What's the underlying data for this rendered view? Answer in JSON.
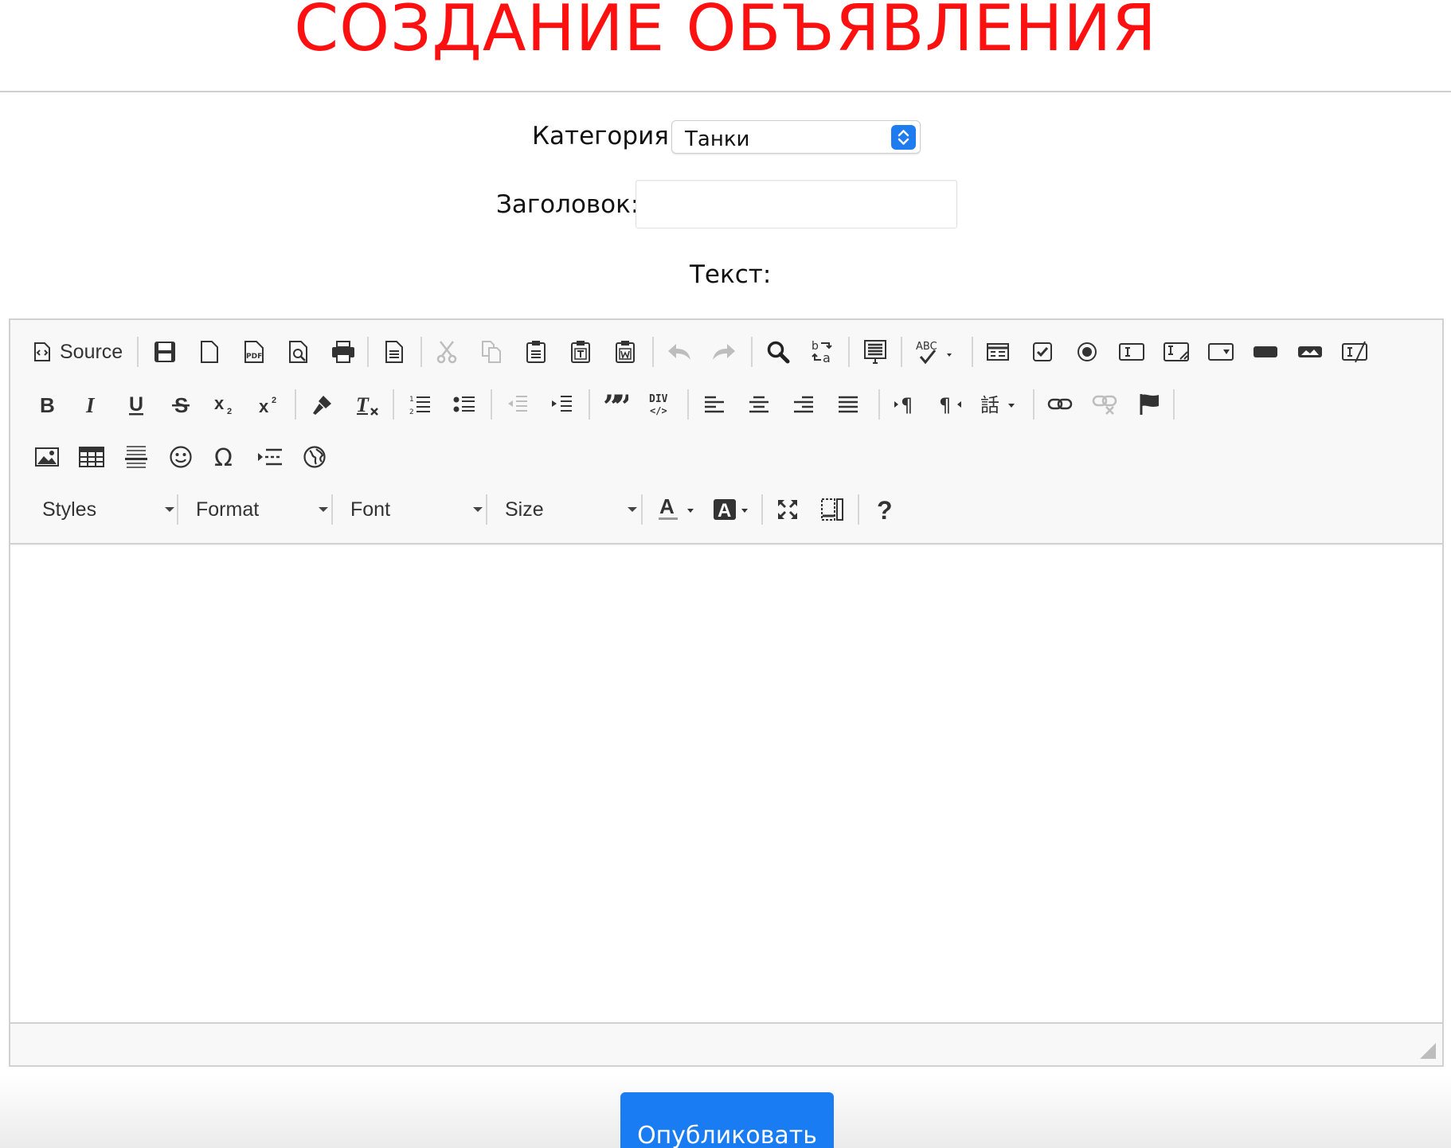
{
  "page": {
    "title": "СОЗДАНИЕ ОБЪЯВЛЕНИЯ"
  },
  "form": {
    "category_label": "Категория:",
    "category_value": "Танки",
    "heading_label": "Заголовок:",
    "heading_value": "",
    "text_label": "Текст:"
  },
  "editor": {
    "source_label": "Source",
    "combos": {
      "styles": "Styles",
      "format": "Format",
      "font": "Font",
      "size": "Size"
    },
    "row1_icons": [
      "source-icon",
      "save-icon",
      "new-page-icon",
      "export-pdf-icon",
      "preview-icon",
      "print-icon",
      "templates-icon",
      "cut-icon",
      "copy-icon",
      "paste-icon",
      "paste-text-icon",
      "paste-word-icon",
      "undo-icon",
      "redo-icon",
      "find-icon",
      "replace-icon",
      "select-all-icon",
      "spellcheck-icon",
      "form-icon",
      "checkbox-icon",
      "radio-icon",
      "textfield-icon",
      "textarea-icon",
      "select-field-icon",
      "button-icon",
      "image-button-icon",
      "hidden-field-icon"
    ],
    "row2_icons": [
      "bold-icon",
      "italic-icon",
      "underline-icon",
      "strike-icon",
      "subscript-icon",
      "superscript-icon",
      "copy-format-icon",
      "remove-format-icon",
      "numbered-list-icon",
      "bulleted-list-icon",
      "outdent-icon",
      "indent-icon",
      "blockquote-icon",
      "div-icon",
      "align-left-icon",
      "align-center-icon",
      "align-right-icon",
      "justify-icon",
      "ltr-icon",
      "rtl-icon",
      "language-icon",
      "link-icon",
      "unlink-icon",
      "anchor-icon"
    ],
    "row3_icons": [
      "image-icon",
      "table-icon",
      "horizontal-line-icon",
      "smiley-icon",
      "special-char-icon",
      "page-break-icon",
      "iframe-icon"
    ],
    "row4_icons": [
      "text-color-icon",
      "bg-color-icon",
      "maximize-icon",
      "show-blocks-icon",
      "about-icon"
    ]
  },
  "actions": {
    "publish_label": "Опубликовать"
  },
  "colors": {
    "title": "#ff1010",
    "primary": "#1a7cf2",
    "icon": "#333333",
    "disabled_icon": "#bdbdbd"
  }
}
